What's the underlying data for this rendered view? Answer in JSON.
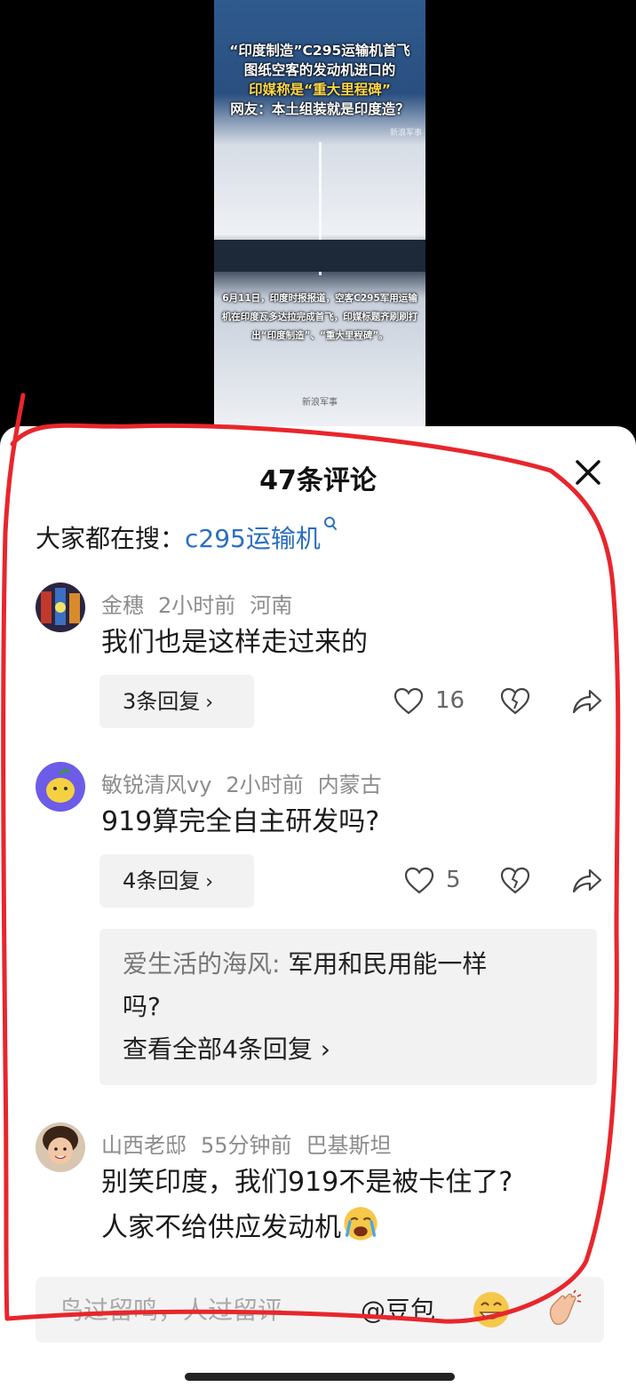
{
  "video": {
    "headline_l1": "“印度制造”C295运输机首飞",
    "headline_l2": "图纸空客的发动机进口的",
    "headline_l3": "印媒称是“重大里程碑”",
    "headline_l4": "网友：本土组装就是印度造？",
    "watermark": "新浪军事",
    "caption": "6月11日，印度时报报道，空客C295军用运输机在印度瓦多达拉完成首飞，印媒标题齐刷刷打出“印度制造”、“重大里程碑”。",
    "logo_text": "新浪军事"
  },
  "sheet": {
    "title": "47条评论",
    "search_prefix": "大家都在搜：",
    "search_keyword": "c295运输机"
  },
  "comments": [
    {
      "user": "金穗",
      "time": "2小时前",
      "location": "河南",
      "text": "我们也是这样走过来的",
      "replies_label": "3条回复",
      "likes": "16"
    },
    {
      "user": "敏锐清风vy",
      "time": "2小时前",
      "location": "内蒙古",
      "text": "919算完全自主研发吗?",
      "replies_label": "4条回复",
      "likes": "5",
      "preview_user": "爱生活的海风",
      "preview_text_l1": "军用和民用能一样",
      "preview_text_l2": "吗?",
      "preview_more": "查看全部4条回复"
    },
    {
      "user": "山西老邸",
      "time": "55分钟前",
      "location": "巴基斯坦",
      "text_l1": "别笑印度，我们919不是被卡住了?",
      "text_l2": "人家不给供应发动机"
    }
  ],
  "input": {
    "placeholder": "鸟过留鸣，人过留评",
    "mention": "@豆包"
  },
  "icons": {
    "close": "close-icon",
    "search": "search-icon",
    "like": "heart-icon",
    "dislike": "broken-heart-icon",
    "share": "share-arrow-icon",
    "emoji_grin": "grin-emoji-icon",
    "emoji_clap": "clap-emoji-icon"
  },
  "colors": {
    "accent_link": "#2a6fbf",
    "annotation": "#e8262c",
    "panel": "#f2f2f2"
  }
}
